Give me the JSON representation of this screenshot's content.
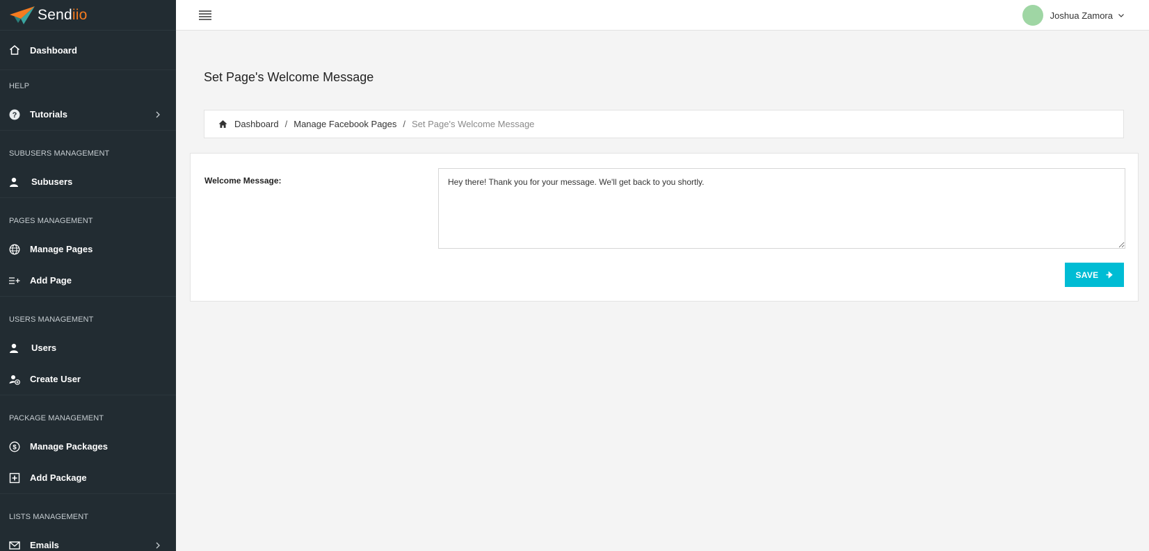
{
  "brand": {
    "name_main": "Send",
    "name_accent": "iio"
  },
  "sidebar": {
    "dashboard": "Dashboard",
    "sections": {
      "help": "HELP",
      "subusers": "SUBUSERS MANAGEMENT",
      "pages": "PAGES MANAGEMENT",
      "users": "USERS MANAGEMENT",
      "packages": "PACKAGE MANAGEMENT",
      "lists": "LISTS MANAGEMENT"
    },
    "items": {
      "tutorials": "Tutorials",
      "subusers": "Subusers",
      "manage_pages": "Manage Pages",
      "add_page": "Add Page",
      "users": "Users",
      "create_user": "Create User",
      "manage_packages": "Manage Packages",
      "add_package": "Add Package",
      "emails": "Emails"
    }
  },
  "topbar": {
    "user_name": "Joshua Zamora"
  },
  "page": {
    "title": "Set Page's Welcome Message"
  },
  "breadcrumb": {
    "items": [
      "Dashboard",
      "Manage Facebook Pages"
    ],
    "current": "Set Page's Welcome Message"
  },
  "form": {
    "label": "Welcome Message:",
    "value": "Hey there! Thank you for your message. We'll get back to you shortly.",
    "save_label": "SAVE"
  },
  "colors": {
    "sidebar": "#222c32",
    "accent": "#00bcd4",
    "brand_orange": "#f47b20",
    "avatar": "#9fd6a4"
  }
}
